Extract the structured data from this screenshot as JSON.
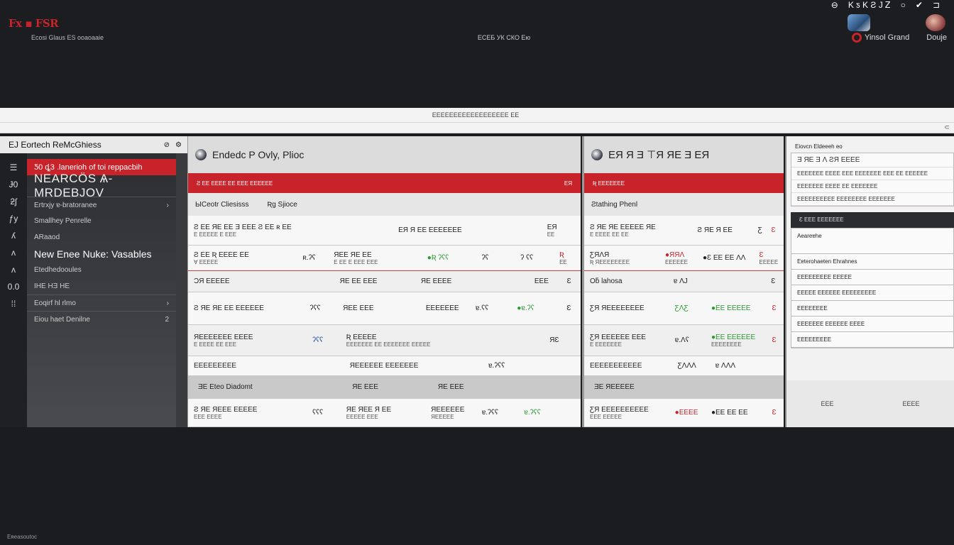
{
  "app": {
    "brand": "Fx ▪ FSR",
    "brand_sub": "Ecosi Glaus ES ooaoaaie",
    "center_title": "ЕСЕБ УК СКО Ею",
    "top_icons": [
      "⊖",
      "K ƽ K Ƨ J Ꮓ",
      "○",
      "✔",
      "⊐"
    ],
    "user_name": "Yinsol",
    "user_name2": "Grand",
    "user_label": "Douje"
  },
  "toolbar": {
    "title": "ЕЕЕЕЕЕЕЕЕЕЕЕЕЕЕЕЕЕ ЕЕ",
    "icon": "⊂"
  },
  "sidebar": {
    "header": "EJ Eortech ReMcGhiess",
    "header_icons": [
      "⊘",
      "⚙"
    ],
    "rail": [
      "☰",
      "Ɉ0",
      "ƻʃ",
      "ƒy",
      "ʎ",
      "ʌ",
      "ʌ",
      "0.0",
      "⁞⁞"
    ],
    "items": [
      {
        "label": "Ƽ0 ȡ3 .lanerioh of toi reppacbih",
        "arrow": "",
        "style": "active"
      },
      {
        "label": "NEARCÖS Ѧ-MRDEBJOV",
        "arrow": "",
        "style": "big"
      },
      {
        "label": "Ertrxjy ɐ-bratoranee",
        "arrow": "›",
        "style": "section"
      },
      {
        "label": "Smallhey Penrelle",
        "arrow": "",
        "style": ""
      },
      {
        "label": "ARaaod",
        "arrow": "",
        "style": ""
      },
      {
        "label": "New Enee Nuke: Vasables",
        "arrow": "",
        "style": "highlight"
      },
      {
        "label": "Etedhedooules",
        "arrow": "",
        "style": ""
      },
      {
        "label": "IHE HƎ HE",
        "arrow": "",
        "style": ""
      },
      {
        "label": "Eoqirf hl rlmo",
        "arrow": "›",
        "style": "section"
      },
      {
        "label": "Eiou haet Denilne",
        "arrow": "2",
        "style": "section"
      }
    ]
  },
  "panel1": {
    "title": "Endedc P Ovly, Plioc",
    "redbar_left": "Ƨ ЕЕ ЕЕЕЕ ЕЕ ЕЕЕ ЕЕЕЕЕЕ",
    "redbar_right": "ЕЯ",
    "subhead": [
      "ЫCeotr Cliesisss",
      "Ʀg Sjioce"
    ],
    "rows": [
      {
        "c": [
          "Ƨ ЕЕ ЯЕ ЕЕ Ǝ ЕЕЕ Ƨ ЕЕ ʀ ЕЕ",
          "ЕЯ Я ЕЕ ЕЕЕЕЕЕЕ",
          "ЕЯ"
        ],
        "sub": [
          "Е ЕЕЕЕЕ Е ЕЕЕ",
          "",
          "ЕЕ"
        ],
        "style": ""
      },
      {
        "c": [
          "Ƨ ЕЕ Ʀ ЕЕЕЕ ЕЕ",
          "ʀ.ʔʕ",
          "ЯЕЕ ЯЕ ЕЕ",
          "●Ʀ ʔʕʕ",
          "ʔʕ",
          "ʔ ʕʕ",
          "Ʀ"
        ],
        "sub": [
          "Ɐ ЕЕЕЕЕ",
          "",
          "Е ЕЕ Е ЕЕЕ ЕЕЕ",
          "",
          "",
          "",
          "ЕЕ"
        ],
        "style": "redline"
      },
      {
        "c": [
          "ƆЯ ЕЕЕЕЕ",
          "ЯЕ ЕЕ ЕЕЕ",
          "ЯЕ ЕЕЕЕ",
          "ЕЕЕ",
          "Ɛ"
        ],
        "sub": [],
        "style": "alt"
      },
      {
        "c": [
          "Ƨ ЯЕ ЯЕ ЕЕ ЕЕЕЕЕЕ",
          "ʔʕʕ",
          "ЯЕЕ ЕЕЕ",
          "ЕЕЕЕЕЕЕ",
          "ɐ.ʕʕ",
          "●ɐ.ʔʕ",
          "Ɛ"
        ],
        "sub": [],
        "style": ""
      },
      {
        "c": [
          "ЯЕЕЕЕЕЕЕ ЕЕЕЕ",
          "ʔʕʕ",
          "Ʀ ЕЕЕЕЕ",
          "ЯƐ"
        ],
        "sub": [
          "Е ЕЕЕЕ ЕЕ ЕЕЕ",
          "",
          "ЕЕЕЕЕЕЕ ЕЕ ЕЕЕЕЕЕЕ ЕЕЕЕЕ",
          ""
        ],
        "style": "alt"
      },
      {
        "c": [
          "ЕЕЕЕЕЕЕЕЕ",
          "ЯЕЕЕЕЕЕ ЕЕЕЕЕЕЕ",
          "ɐ.ʔʕʕ"
        ],
        "sub": [],
        "style": ""
      },
      {
        "c": [
          "ƎЕ Eteo Diadomt",
          "ЯЕ ЕЕЕ",
          "ЯЕ ЕЕЕ"
        ],
        "sub": [],
        "style": "gray"
      },
      {
        "c": [
          "Ƨ ЯЕ ЯЕЕЕ ЕЕЕЕЕ",
          "ʕʕʕ",
          "ЯЕ ЯЕЕ Я ЕЕ",
          "ЯЕЕЕЕЕЕ",
          "ɐ.ʔʕʕ",
          "ɐ.ʔʕʕ"
        ],
        "sub": [
          "ЕЕЕ ЕЕЕЕ",
          "",
          "ЕЕЕЕЕ ЕЕЕ",
          "ЯЕЕЕЕЕ"
        ],
        "style": ""
      }
    ]
  },
  "panel2": {
    "title": "ЕЯ Я Ǝ ⊤Я ЯЕ Ǝ ЕЯ",
    "redbar_left": "Ʀ ЕЕЕЕЕЕЕ",
    "subhead": [
      "Ƨtathing Phenl"
    ],
    "rows": [
      {
        "c": [
          "Ƨ ЯЕ ЯЕ ЕЕЕЕЕ ЯЕ",
          "Ƨ ЯЕ Я ЕЕ",
          "Ƹ",
          "Ɛ"
        ],
        "sub": [
          "Е ЕЕЕЕ ЕЕ ЕЕ",
          "",
          "",
          ""
        ]
      },
      {
        "c": [
          "ƸЯɅЯ",
          "●ЯЯɅ",
          "●Ɛ ЕЕ ЕЕ ɅɅ",
          "Ɛ"
        ],
        "sub": [
          "Ʀ ЯЕЕЕЕЕЕЕЕ",
          "ЕЕЕЕЕЕ",
          "",
          "ЕЕЕЕЕ"
        ],
        "style": "redline"
      },
      {
        "c": [
          "Oƃ lahosa",
          "ɐ ɅJ",
          "Ɛ"
        ],
        "sub": [],
        "style": "alt"
      },
      {
        "c": [
          "ƸЯ ЯЕЕЕЕЕЕЕЕ",
          "ƸɅƸ",
          "●ЕЕ ЕЕЕЕЕ",
          "Ɛ"
        ],
        "sub": []
      },
      {
        "c": [
          "ƸЯ ЕЕЕЕЕЕ ЕЕЕ",
          "ɐ.Ʌʕ",
          "●ЕЕ ЕЕЕЕЕЕ",
          "Ɛ"
        ],
        "sub": [
          "Е ЕЕЕЕЕЕЕ",
          "",
          "ЕЕЕЕЕЕЕЕ",
          ""
        ],
        "style": "alt"
      },
      {
        "c": [
          "ЕЕЕЕЕЕЕЕЕЕЕ",
          "ƸɅɅɅ",
          "ɐ ɅɅɅ"
        ],
        "sub": []
      },
      {
        "c": [
          "ƎЕ ЯЕЕЕЕЕ"
        ],
        "sub": [],
        "style": "gray"
      },
      {
        "c": [
          "ƸЯ ЕЕЕЕЕЕЕЕЕЕ",
          "●ЕЕЕЕ",
          "●ЕЕ ЕЕ ЕЕ",
          "Ɛ"
        ],
        "sub": [
          "ЕЕЕ ЕЕЕЕЕ",
          "",
          "",
          ""
        ]
      }
    ]
  },
  "panel3": {
    "title": "Eiovcn Eldeeeh eo",
    "box_lines": [
      "Ǝ ЯЕ Ǝ Ʌ ƧЯ ЕЕЕЕ",
      "ЕЕЕЕЕЕЕ ЕЕЕЕ ЕЕЕ ЕЕЕЕЕЕЕ ЕЕЕ ЕЕ ЕЕЕЕЕЕ",
      "ЕЕЕЕЕЕЕ ЕЕЕЕ ЕЕ ЕЕЕЕЕЕЕ",
      "ЕЕЕЕЕЕЕЕЕЕ ЕЕЕЕЕЕЕЕ ЕЕЕЕЕЕЕ"
    ],
    "dark": "Ɛ ЕЕЕ ЕЕЕЕЕЕЕ",
    "list": [
      "Aeareɐhe",
      "Eɐterohaeten Ehrahnes",
      "ЕЕЕЕЕЕЕЕЕ ЕЕЕЕЕ",
      "ЕЕЕЕЕ ЕЕЕЕЕЕ ЕЕЕЕЕЕЕЕЕ",
      "ЕЕЕЕЕЕЕЕ",
      "ЕЕЕЕЕЕЕ ЕЕЕЕЕЕ ЕЕЕЕ",
      "ЕЕЕЕЕЕЕЕЕ"
    ],
    "footer": [
      "ЕЕЕ",
      "ЕЕЕЕ"
    ]
  },
  "status": "Eʀeasoutoc"
}
